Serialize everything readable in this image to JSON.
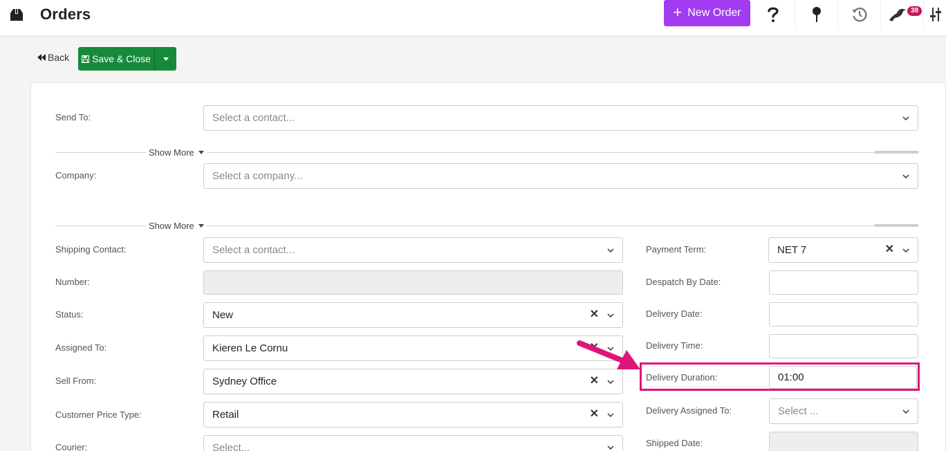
{
  "header": {
    "title": "Orders",
    "new_order_label": "New Order",
    "notification_count": "38"
  },
  "actions": {
    "back_label": "Back",
    "save_close_label": "Save & Close"
  },
  "form": {
    "send_to": {
      "label": "Send To:",
      "placeholder": "Select a contact..."
    },
    "show_more_1": "Show More",
    "company": {
      "label": "Company:",
      "placeholder": "Select a company..."
    },
    "show_more_2": "Show More",
    "shipping_contact": {
      "label": "Shipping Contact:",
      "placeholder": "Select a contact..."
    },
    "number": {
      "label": "Number:",
      "value": ""
    },
    "status": {
      "label": "Status:",
      "value": "New"
    },
    "assigned_to": {
      "label": "Assigned To:",
      "value": "Kieren Le Cornu"
    },
    "sell_from": {
      "label": "Sell From:",
      "value": "Sydney Office"
    },
    "customer_price_type": {
      "label": "Customer Price Type:",
      "value": "Retail"
    },
    "courier": {
      "label": "Courier:",
      "placeholder": "Select..."
    },
    "payment_term": {
      "label": "Payment Term:",
      "value": "NET 7"
    },
    "despatch_by_date": {
      "label": "Despatch By Date:",
      "value": ""
    },
    "delivery_date": {
      "label": "Delivery Date:",
      "value": ""
    },
    "delivery_time": {
      "label": "Delivery Time:",
      "value": ""
    },
    "delivery_duration": {
      "label": "Delivery Duration:",
      "value": "01:00"
    },
    "delivery_assigned_to": {
      "label": "Delivery Assigned To:",
      "placeholder": "Select ..."
    },
    "shipped_date": {
      "label": "Shipped Date:",
      "value": ""
    }
  },
  "annotation": {
    "color": "#e0157a"
  },
  "colors": {
    "primary": "#a23cf0",
    "save": "#168a3a",
    "badge": "#c2185b"
  }
}
